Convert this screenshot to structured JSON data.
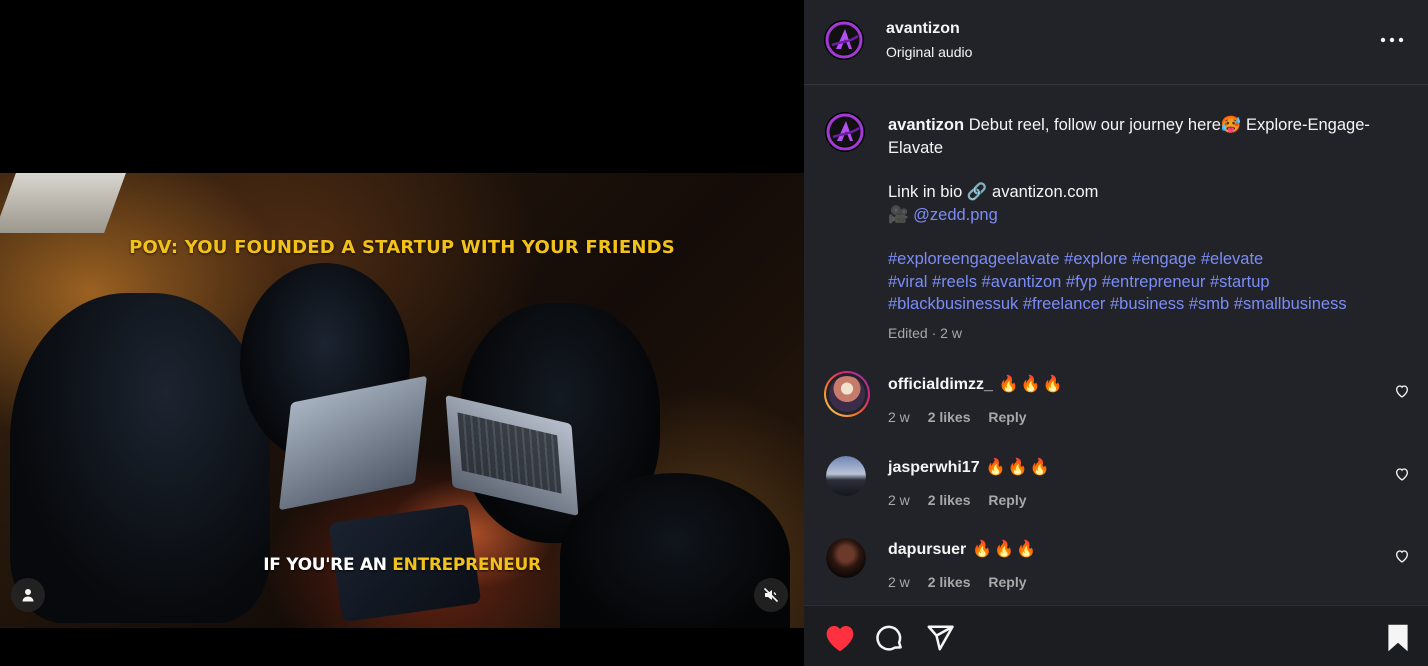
{
  "video": {
    "caption_top": "POV: YOU FOUNDED A STARTUP WITH YOUR FRIENDS",
    "caption_bottom_prefix": "IF YOU'RE AN ",
    "caption_bottom_highlight": "ENTREPRENEUR",
    "highlight_color": "#f2c21a",
    "user_icon": "person-icon",
    "mute_icon": "speaker-muted-icon"
  },
  "header": {
    "username": "avantizon",
    "audio": "Original audio",
    "more_icon": "more-horizontal-icon"
  },
  "post": {
    "username": "avantizon",
    "line1": " Debut reel, follow our journey here🥵 Explore-Engage-Elavate",
    "link_line_prefix": "Link in bio 🔗 avantizon.com",
    "mention_emoji": "🎥",
    "mention": "@zedd.png",
    "hashtag_lines": [
      "#exploreengageelavate #explore #engage #elevate",
      "#viral #reels #avantizon #fyp #entrepreneur #startup",
      "#blackbusinessuk #freelancer #business #smb #smallbusiness"
    ],
    "edited": "Edited · 2 w",
    "link_color": "#7b8cf7"
  },
  "comments": [
    {
      "username": "officialdimzz_",
      "text": "🔥🔥🔥",
      "age": "2 w",
      "likes": "2 likes",
      "reply": "Reply"
    },
    {
      "username": "jasperwhi17",
      "text": "🔥🔥🔥",
      "age": "2 w",
      "likes": "2 likes",
      "reply": "Reply"
    },
    {
      "username": "dapursuer",
      "text": "🔥🔥🔥",
      "age": "2 w",
      "likes": "2 likes",
      "reply": "Reply"
    }
  ],
  "actions": {
    "like_icon": "heart-filled-icon",
    "like_color": "#ff3040",
    "comment_icon": "comment-bubble-icon",
    "share_icon": "paper-plane-icon",
    "save_icon": "bookmark-filled-icon"
  }
}
